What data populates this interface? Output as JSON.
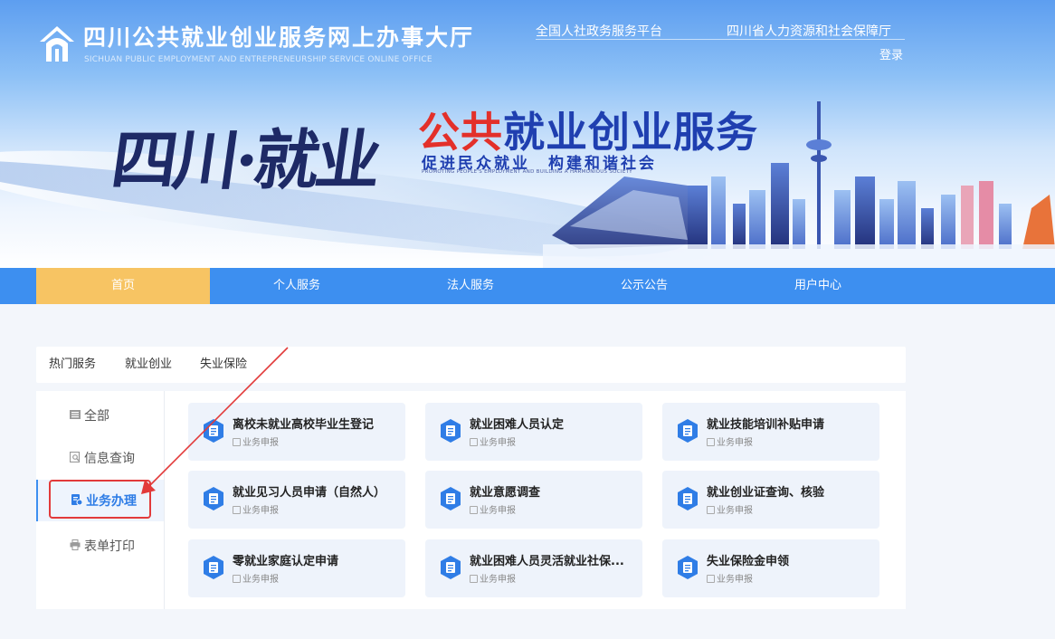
{
  "header": {
    "title": "四川公共就业创业服务网上办事大厅",
    "subtitle": "SICHUAN PUBLIC EMPLOYMENT AND ENTREPRENEURSHIP SERVICE ONLINE OFFICE",
    "links": [
      "全国人社政务服务平台",
      "四川省人力资源和社会保障厅"
    ],
    "login": "登录"
  },
  "banner": {
    "calligraphy": "四川·就业",
    "slogan_red": "公共",
    "slogan_blue": "就业创业服务",
    "slogan_sub": "促进民众就业　构建和谐社会",
    "slogan_en": "PROMOTING PEOPLE'S EMPLOYMENT AND BUILDING A HARMONIOUS SOCIETY"
  },
  "nav": {
    "items": [
      "首页",
      "个人服务",
      "法人服务",
      "公示公告",
      "用户中心"
    ],
    "active": "首页"
  },
  "tabs": [
    "热门服务",
    "就业创业",
    "失业保险"
  ],
  "sidebar": {
    "items": [
      "全部",
      "信息查询",
      "业务办理",
      "表单打印"
    ],
    "active": "业务办理"
  },
  "cards": [
    {
      "title": "离校未就业高校毕业生登记",
      "tag": "业务申报"
    },
    {
      "title": "就业困难人员认定",
      "tag": "业务申报"
    },
    {
      "title": "就业技能培训补贴申请",
      "tag": "业务申报"
    },
    {
      "title": "就业见习人员申请（自然人）",
      "tag": "业务申报"
    },
    {
      "title": "就业意愿调查",
      "tag": "业务申报"
    },
    {
      "title": "就业创业证查询、核验",
      "tag": "业务申报"
    },
    {
      "title": "零就业家庭认定申请",
      "tag": "业务申报"
    },
    {
      "title": "就业困难人员灵活就业社保...",
      "tag": "业务申报"
    },
    {
      "title": "失业保险金申领",
      "tag": "业务申报"
    }
  ],
  "colors": {
    "nav_bg": "#3d8ff0",
    "nav_active": "#f7c463",
    "highlight": "#e23a3a",
    "card_bg": "#eef3fb",
    "icon_blue": "#2f7de6"
  },
  "icons": {
    "logo": "house-logo-icon",
    "sidebar": [
      "list-icon",
      "query-icon",
      "handle-icon",
      "print-icon"
    ],
    "card": "document-badge-icon",
    "tag": "form-icon"
  }
}
